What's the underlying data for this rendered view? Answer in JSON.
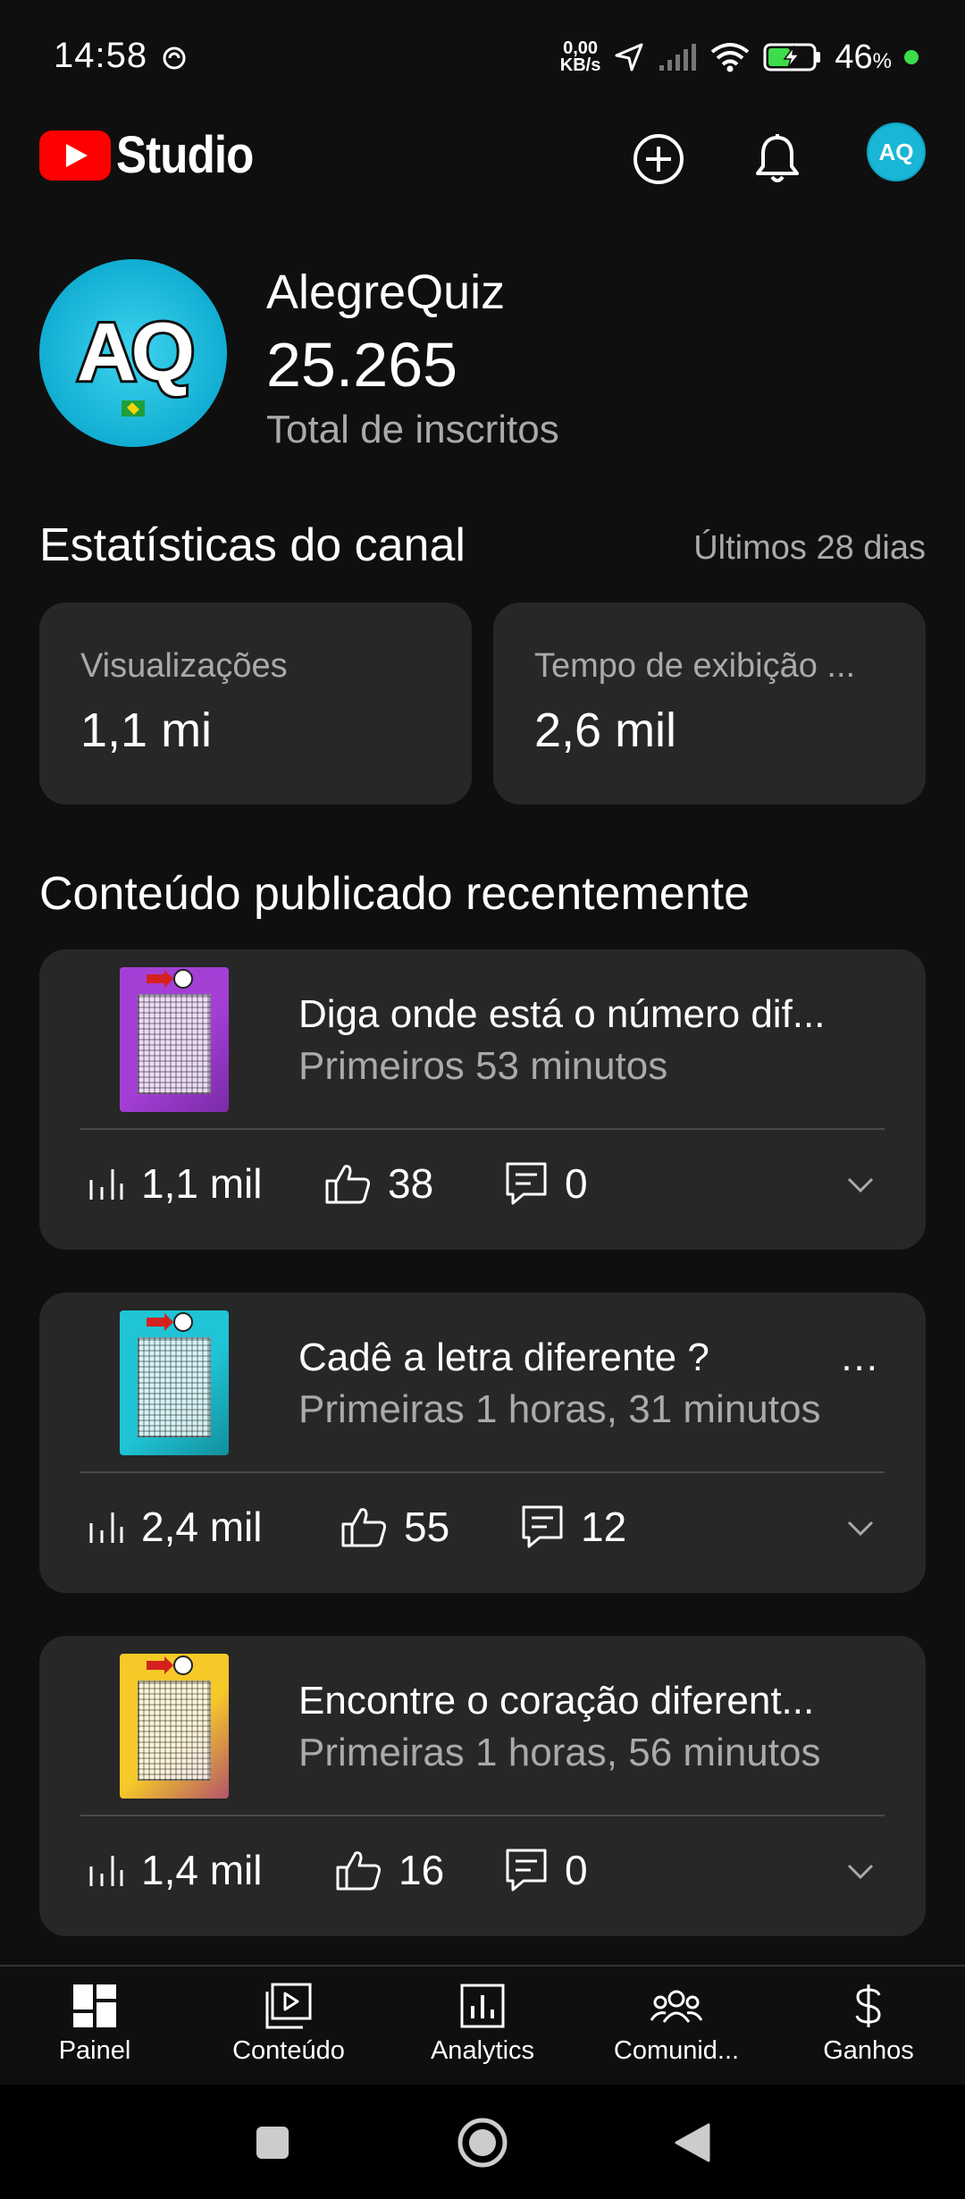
{
  "status_bar": {
    "time": "14:58",
    "net_speed_value": "0,00",
    "net_speed_unit": "KB/s",
    "battery_percent": "46",
    "battery_unit": "%"
  },
  "app_bar": {
    "brand": "Studio",
    "avatar_initials": "AQ"
  },
  "channel": {
    "avatar_initials": "AQ",
    "name": "AlegreQuiz",
    "subscribers": "25.265",
    "subscribers_label": "Total de inscritos"
  },
  "stats": {
    "title": "Estatísticas do canal",
    "period": "Últimos 28 dias",
    "cards": [
      {
        "label": "Visualizações",
        "value": "1,1 mi"
      },
      {
        "label": "Tempo de exibição ...",
        "value": "2,6 mil"
      }
    ]
  },
  "recent": {
    "title": "Conteúdo publicado recentemente",
    "items": [
      {
        "title": "Diga onde está o número dif...",
        "subtitle": "Primeiros 53 minutos",
        "views": "1,1 mil",
        "likes": "38",
        "comments": "0",
        "thumb_color": "#a43fd6",
        "thumb_accent": "#7a2ba8",
        "has_more": false
      },
      {
        "title": "Cadê a letra diferente ?",
        "subtitle": "Primeiras 1 horas, 31 minutos",
        "views": "2,4 mil",
        "likes": "55",
        "comments": "12",
        "thumb_color": "#1fc4d6",
        "thumb_accent": "#138f9c",
        "has_more": true,
        "more": "..."
      },
      {
        "title": "Encontre o coração diferent...",
        "subtitle": "Primeiras 1 horas, 56 minutos",
        "views": "1,4 mil",
        "likes": "16",
        "comments": "0",
        "thumb_color": "#f6c928",
        "thumb_accent": "#b3546a",
        "has_more": false
      }
    ]
  },
  "bottom_nav": [
    {
      "label": "Painel",
      "icon": "dashboard-icon"
    },
    {
      "label": "Conteúdo",
      "icon": "content-icon"
    },
    {
      "label": "Analytics",
      "icon": "analytics-icon"
    },
    {
      "label": "Comunid...",
      "icon": "community-icon"
    },
    {
      "label": "Ganhos",
      "icon": "dollar-icon"
    }
  ]
}
